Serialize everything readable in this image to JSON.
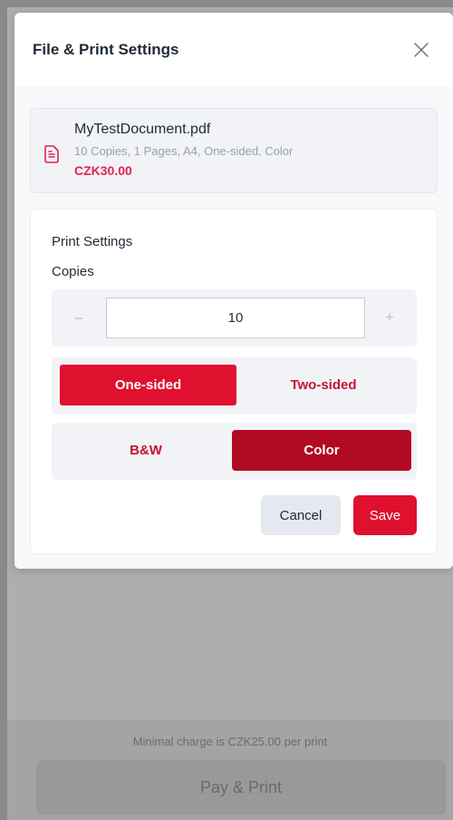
{
  "modal": {
    "title": "File & Print Settings",
    "close_icon": "close-icon"
  },
  "file": {
    "icon": "document-icon",
    "name": "MyTestDocument.pdf",
    "details": "10 Copies, 1 Pages, A4, One-sided, Color",
    "price": "CZK30.00"
  },
  "settings": {
    "section_title": "Print Settings",
    "copies_label": "Copies",
    "copies_value": "10",
    "minus_label": "–",
    "plus_label": "+",
    "sides": {
      "options": [
        "One-sided",
        "Two-sided"
      ],
      "selected": "One-sided"
    },
    "color_mode": {
      "options": [
        "B&W",
        "Color"
      ],
      "selected": "Color"
    },
    "cancel_label": "Cancel",
    "save_label": "Save"
  },
  "footer": {
    "min_charge_text": "Minimal charge is CZK25.00 per print",
    "pay_label": "Pay & Print"
  },
  "colors": {
    "accent": "#e0102f",
    "accent_dark": "#b10b23",
    "price": "#e1244f"
  }
}
